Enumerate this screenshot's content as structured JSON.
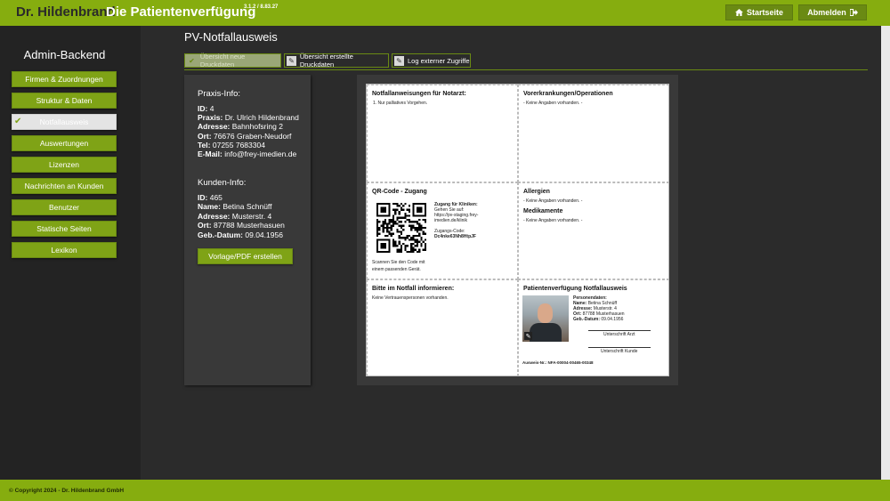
{
  "header": {
    "brand": "Dr. Hildenbrand",
    "title": "Die Patientenverfügung",
    "version": "3.1.2 / 8.83.27",
    "home_label": "Startseite",
    "logout_label": "Abmelden"
  },
  "sidebar": {
    "title": "Admin-Backend",
    "items": [
      {
        "label": "Firmen & Zuordnungen"
      },
      {
        "label": "Struktur & Daten"
      },
      {
        "label": "Notfallausweis"
      },
      {
        "label": "Auswertungen"
      },
      {
        "label": "Lizenzen"
      },
      {
        "label": "Nachrichten an Kunden"
      },
      {
        "label": "Benutzer"
      },
      {
        "label": "Statische Seiten"
      },
      {
        "label": "Lexikon"
      }
    ]
  },
  "main": {
    "title": "PV-Notfallausweis",
    "tabs": [
      {
        "label": "Übersicht neue Druckdaten"
      },
      {
        "label": "Übersicht erstellte Druckdaten"
      },
      {
        "label": "Log externer Zugriffe"
      }
    ]
  },
  "praxis": {
    "title": "Praxis-Info:",
    "id_label": "ID:",
    "id": "4",
    "praxis_label": "Praxis:",
    "praxis": "Dr. Ulrich Hildenbrand",
    "adresse_label": "Adresse:",
    "adresse": "Bahnhofsring 2",
    "ort_label": "Ort:",
    "ort": "76676 Graben-Neudorf",
    "tel_label": "Tel:",
    "tel": "07255 7683304",
    "email_label": "E-Mail:",
    "email": "info@frey-imedien.de"
  },
  "kunde": {
    "title": "Kunden-Info:",
    "id_label": "ID:",
    "id": "465",
    "name_label": "Name:",
    "name": "Betina Schnüff",
    "adresse_label": "Adresse:",
    "adresse": "Musterstr. 4",
    "ort_label": "Ort:",
    "ort": "87788 Musterhasuen",
    "geb_label": "Geb.-Datum:",
    "geb": "09.04.1956"
  },
  "pdf_button": "Vorlage/PDF erstellen",
  "card": {
    "notarzt_title": "Notfallanweisungen für Notarzt:",
    "notarzt_item": "1. Nur palliatives Vorgehen.",
    "vorerkrankungen_title": "Vorerkrankungen/Operationen",
    "vorerkrankungen_text": "- Keine Angaben vorhanden. -",
    "qr_title": "QR-Code - Zugang",
    "zugang_title": "Zugang für Kliniken:",
    "zugang_line1": "Gehen Sie auf:",
    "zugang_line2": "https://pv-staging.frey-",
    "zugang_line3": "imedien.de/klinik",
    "zugangscode_label": "Zugangs-Code:",
    "zugangscode": "Dc4nke63Nh8HtpJF",
    "scan_line1": "Scannen Sie den Code mit",
    "scan_line2": "einem passenden Gerät.",
    "allergien_title": "Allergien",
    "allergien_text": "- Keine Angaben vorhanden. -",
    "medikamente_title": "Medikamente",
    "medikamente_text": "- Keine Angaben vorhanden. -",
    "informieren_title": "Bitte im Notfall informieren:",
    "informieren_text": "Keine Vertrauenspersonen vorhanden.",
    "pv_title": "Patientenverfügung Notfallausweis",
    "personendaten": "Personendaten:",
    "name_label": "Name:",
    "name": "Betina Schnüff",
    "adresse_label": "Adresse:",
    "adresse": "Musterstr. 4",
    "ort_label": "Ort:",
    "ort": "87788 Musterhasuen",
    "geb_label": "Geb.-Datum:",
    "geb": "09.04.1956",
    "sig_arzt": "Unterschrift Arzt",
    "sig_kunde": "Unterschrift Kunde",
    "ausweis_nr": "Ausweis-Nr.: NFA-00004-00465-00348"
  },
  "footer": {
    "copyright": "© Copyright 2024 - Dr. Hildenbrand GmbH"
  }
}
